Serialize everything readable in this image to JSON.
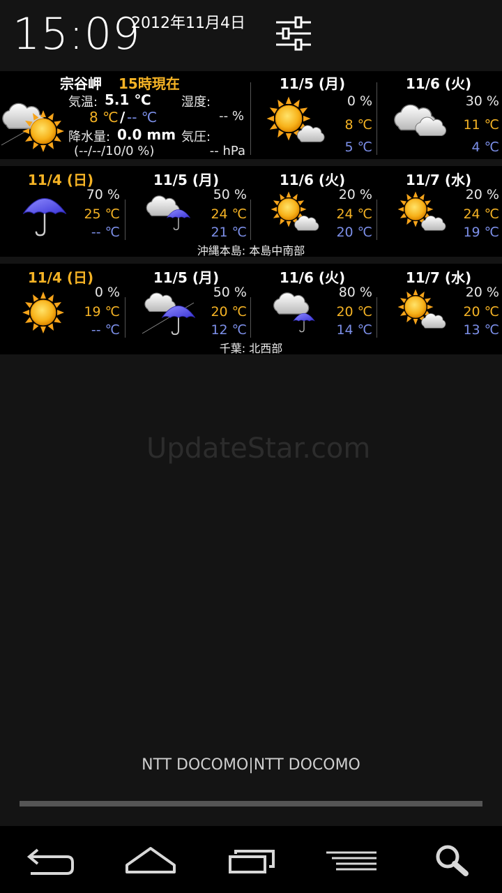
{
  "header": {
    "time": "15:09",
    "date": "2012年11月4日"
  },
  "current": {
    "location": "宗谷岬",
    "as_of": "15時現在",
    "temp_label": "気温:",
    "temp_value": "5.1 ℃",
    "hi": "8 ℃",
    "slash": "/",
    "lo": "-- ℃",
    "humidity_label": "湿度:",
    "humidity_value": "-- %",
    "precip_label": "降水量:",
    "precip_value": "0.0 mm",
    "pressure_label": "気圧:",
    "pressure_value": "-- hPa",
    "precip_history": "(--/--/10/0 %)",
    "forecast": [
      {
        "day": "11/5 (月)",
        "pct": "0 %",
        "hi": "8 ℃",
        "lo": "5 ℃",
        "icon": "sun-cloud"
      },
      {
        "day": "11/6 (火)",
        "pct": "30 %",
        "hi": "11 ℃",
        "lo": "4 ℃",
        "icon": "cloud"
      }
    ]
  },
  "okinawa": {
    "caption": "沖縄本島: 本島中南部",
    "days": [
      {
        "day": "11/4 (日)",
        "pct": "70 %",
        "hi": "25 ℃",
        "lo": "-- ℃",
        "icon": "umbrella",
        "today": true
      },
      {
        "day": "11/5 (月)",
        "pct": "50 %",
        "hi": "24 ℃",
        "lo": "21 ℃",
        "icon": "cloud-umbrella"
      },
      {
        "day": "11/6 (火)",
        "pct": "20 %",
        "hi": "24 ℃",
        "lo": "20 ℃",
        "icon": "sun-cloud"
      },
      {
        "day": "11/7 (水)",
        "pct": "20 %",
        "hi": "24 ℃",
        "lo": "19 ℃",
        "icon": "sun-cloud"
      }
    ]
  },
  "chiba": {
    "caption": "千葉: 北西部",
    "days": [
      {
        "day": "11/4 (日)",
        "pct": "0 %",
        "hi": "19 ℃",
        "lo": "-- ℃",
        "icon": "sun",
        "today": true
      },
      {
        "day": "11/5 (月)",
        "pct": "50 %",
        "hi": "20 ℃",
        "lo": "12 ℃",
        "icon": "cloud-umbrella-slash"
      },
      {
        "day": "11/6 (火)",
        "pct": "80 %",
        "hi": "20 ℃",
        "lo": "14 ℃",
        "icon": "cloud-umbrella"
      },
      {
        "day": "11/7 (水)",
        "pct": "20 %",
        "hi": "20 ℃",
        "lo": "13 ℃",
        "icon": "sun-cloud"
      }
    ]
  },
  "background": {
    "brand": "UpdateStar.com"
  },
  "footer": {
    "carrier": "NTT DOCOMO|NTT DOCOMO"
  },
  "colors": {
    "accent_orange": "#f5b325",
    "low_temp_blue": "#7c8fe8",
    "panel_bg": "#000000"
  }
}
